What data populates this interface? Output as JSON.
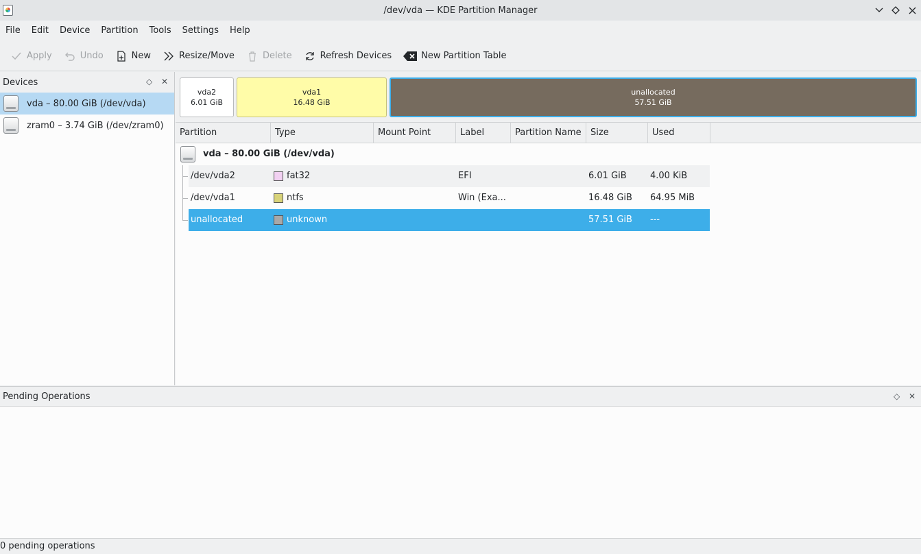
{
  "window": {
    "title": "/dev/vda — KDE Partition Manager",
    "controls": [
      "minimize",
      "maximize",
      "close"
    ]
  },
  "menubar": [
    "File",
    "Edit",
    "Device",
    "Partition",
    "Tools",
    "Settings",
    "Help"
  ],
  "toolbar": {
    "apply": "Apply",
    "undo": "Undo",
    "new": "New",
    "resize": "Resize/Move",
    "delete": "Delete",
    "refresh": "Refresh Devices",
    "new_table": "New Partition Table"
  },
  "devices": {
    "header": "Devices",
    "items": [
      {
        "label": "vda – 80.00 GiB (/dev/vda)",
        "selected": true
      },
      {
        "label": "zram0 – 3.74 GiB (/dev/zram0)",
        "selected": false
      }
    ]
  },
  "graph": [
    {
      "name": "vda2",
      "size": "6.01 GiB",
      "color": "#ffffff"
    },
    {
      "name": "vda1",
      "size": "16.48 GiB",
      "color": "#fffca8"
    },
    {
      "name": "unallocated",
      "size": "57.51 GiB",
      "color": "#766b5e"
    }
  ],
  "table": {
    "columns": [
      "Partition",
      "Type",
      "Mount Point",
      "Label",
      "Partition Name",
      "Size",
      "Used"
    ],
    "device_row": "vda – 80.00 GiB (/dev/vda)",
    "rows": [
      {
        "partition": "/dev/vda2",
        "type": "fat32",
        "type_color": "#f2d1f2",
        "mount": "",
        "label": "EFI",
        "pname": "",
        "size": "6.01 GiB",
        "used": "4.00 KiB"
      },
      {
        "partition": "/dev/vda1",
        "type": "ntfs",
        "type_color": "#d8d37a",
        "mount": "",
        "label": "Win (Exa...",
        "pname": "",
        "size": "16.48 GiB",
        "used": "64.95 MiB"
      },
      {
        "partition": "unallocated",
        "type": "unknown",
        "type_color": "#a8a8a8",
        "mount": "",
        "label": "",
        "pname": "",
        "size": "57.51 GiB",
        "used": "---"
      }
    ]
  },
  "pending": {
    "header": "Pending Operations",
    "status": "0 pending operations"
  }
}
